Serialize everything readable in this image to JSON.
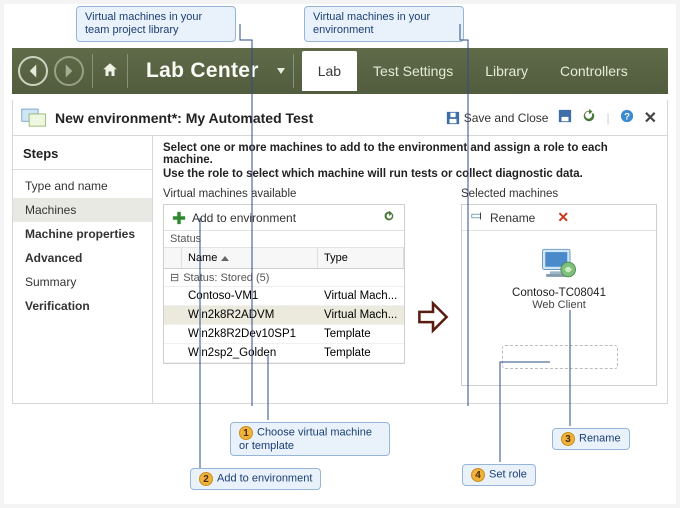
{
  "annotations": {
    "top_left": "Virtual machines in your team project library",
    "top_right": "Virtual machines in your environment",
    "n1": "Choose virtual machine or template",
    "n2": "Add to environment",
    "n3": "Rename",
    "n4": "Set role"
  },
  "ribbon": {
    "brand": "Lab Center",
    "tabs": [
      "Lab",
      "Test Settings",
      "Library",
      "Controllers"
    ]
  },
  "title": {
    "text": "New environment*: My Automated Test",
    "save_label": "Save and Close"
  },
  "steps": {
    "header": "Steps",
    "items": [
      "Type and name",
      "Machines",
      "Machine properties",
      "Advanced",
      "Summary",
      "Verification"
    ],
    "selected_index": 1,
    "bold_indices": [
      2,
      3,
      5
    ]
  },
  "content": {
    "instruction_line1": "Select one or more machines to add to the environment and assign a role to each machine.",
    "instruction_line2": "Use the role to select which machine will run tests or collect diagnostic data.",
    "left_header": "Virtual machines available",
    "right_header": "Selected machines",
    "add_label": "Add to environment",
    "status_label": "Status",
    "col_name": "Name",
    "col_type": "Type",
    "group_label": "Status: Stored (5)",
    "rows": [
      {
        "name": "Contoso-VM1",
        "type": "Virtual Mach..."
      },
      {
        "name": "Win2k8R2ADVM",
        "type": "Virtual Mach..."
      },
      {
        "name": "Win2k8R2Dev10SP1",
        "type": "Template"
      },
      {
        "name": "Win2sp2_Golden",
        "type": "Template"
      }
    ],
    "selected_row_index": 1,
    "rename_label": "Rename",
    "selected_vm": {
      "name": "Contoso-TC08041",
      "role": "Web Client"
    }
  }
}
